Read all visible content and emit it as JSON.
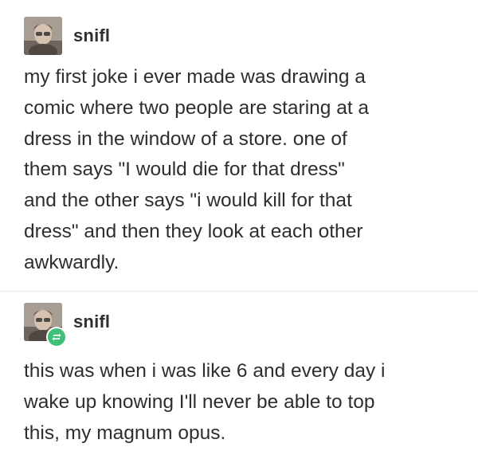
{
  "posts": [
    {
      "username": "snifl",
      "avatar_icon": "user-avatar",
      "body": "my first joke i ever made was drawing a\ncomic where two people are staring at a\ndress in the window of a store. one of\nthem says \"I would die for that dress\"\nand the other says \"i would kill for that\ndress\" and then they look at each other\nawkwardly."
    },
    {
      "username": "snifl",
      "avatar_icon": "user-avatar",
      "reblog_icon": "reblog-icon",
      "body": "this was when i was like 6 and every day i\nwake up knowing I'll never be able to top\nthis, my magnum opus."
    }
  ],
  "colors": {
    "text": "#2e2e2e",
    "reblog_badge": "#3ec07a",
    "divider": "#ececec"
  }
}
